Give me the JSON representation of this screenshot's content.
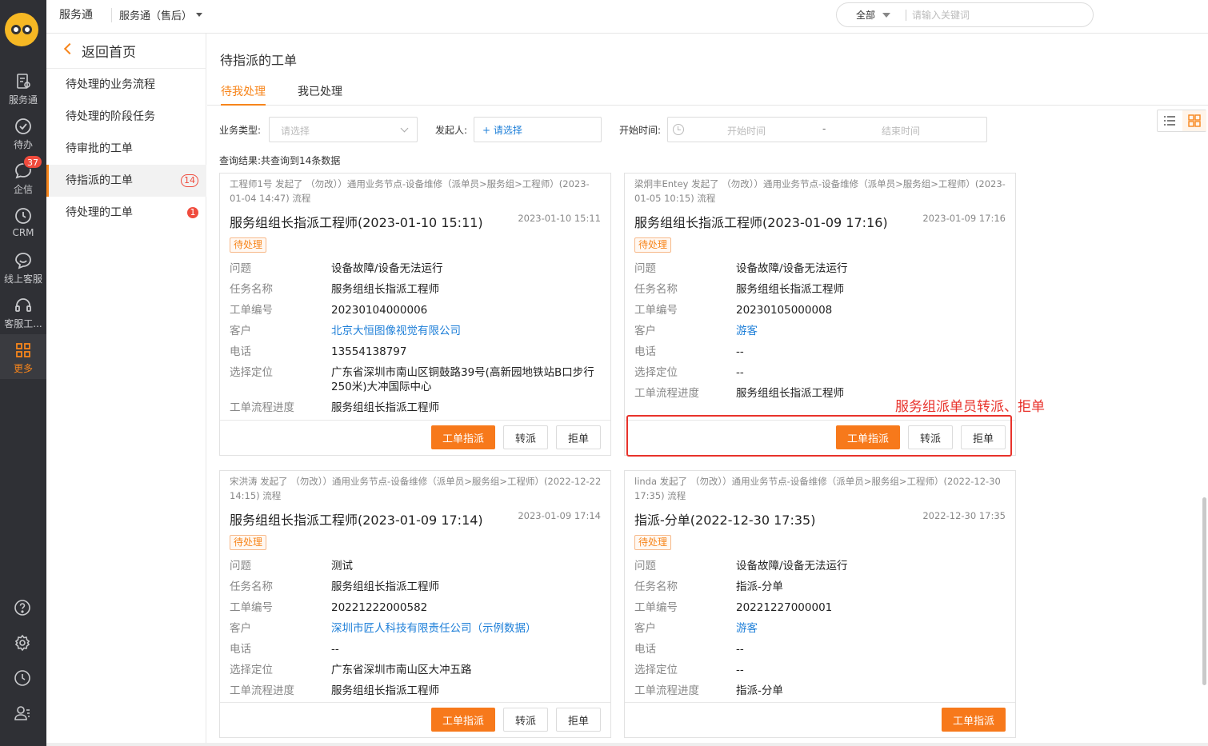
{
  "colors": {
    "accent": "#f7851b",
    "primary_button": "#f7791b",
    "link": "#1e7fd8",
    "badge": "#f04b3d",
    "rail_bg": "#2f3035",
    "annotation": "#e8322b"
  },
  "rail": {
    "items": [
      {
        "label": "服务通",
        "icon": "service-icon"
      },
      {
        "label": "待办",
        "icon": "check-circle-icon"
      },
      {
        "label": "企信",
        "icon": "chat-bubble-icon",
        "badge": "37"
      },
      {
        "label": "CRM",
        "icon": "clock-icon"
      },
      {
        "label": "线上客服",
        "icon": "online-service-icon"
      },
      {
        "label": "客服工...",
        "icon": "headset-icon"
      },
      {
        "label": "更多",
        "icon": "grid-icon"
      }
    ],
    "bottom_icons": [
      "help-icon",
      "settings-icon",
      "history-icon",
      "contacts-icon"
    ]
  },
  "topbar": {
    "brand": "服务通",
    "scope": "服务通（售后）",
    "search_scope": "全部",
    "search_placeholder": "请输入关键词"
  },
  "sidenav": {
    "back": "返回首页",
    "items": [
      {
        "label": "待处理的业务流程"
      },
      {
        "label": "待处理的阶段任务"
      },
      {
        "label": "待审批的工单"
      },
      {
        "label": "待指派的工单",
        "count": "14"
      },
      {
        "label": "待处理的工单",
        "count": "1"
      }
    ]
  },
  "main": {
    "title": "待指派的工单",
    "tabs": [
      "待我处理",
      "我已处理"
    ],
    "filters": {
      "type_label": "业务类型:",
      "type_placeholder": "请选择",
      "initiator_label": "发起人:",
      "initiator_placeholder": "+ 请选择",
      "time_label": "开始时间:",
      "start_placeholder": "开始时间",
      "range_sep": "-",
      "end_placeholder": "结束时间"
    },
    "result_text": "查询结果:共查询到14条数据"
  },
  "field_labels": [
    "问题",
    "任务名称",
    "工单编号",
    "客户",
    "电话",
    "选择定位",
    "工单流程进度"
  ],
  "buttons": {
    "assign": "工单指派",
    "transfer": "转派",
    "reject": "拒单"
  },
  "cards": [
    {
      "initiator": "工程师1号 发起了 （勿改））通用业务节点-设备维修（派单员>服务组>工程师）(2023-01-04 14:47) 流程",
      "title": "服务组组长指派工程师(2023-01-10 15:11)",
      "time": "2023-01-10 15:11",
      "status": "待处理",
      "values": [
        "设备故障/设备无法运行",
        "服务组组长指派工程师",
        "20230104000006",
        "北京大恒图像视觉有限公司",
        "13554138797",
        "广东省深圳市南山区铜鼓路39号(高新园地铁站B口步行250米)大冲国际中心",
        "服务组组长指派工程师"
      ]
    },
    {
      "initiator": "梁炯丰Entey 发起了 （勿改））通用业务节点-设备维修（派单员>服务组>工程师）(2023-01-05 10:15) 流程",
      "title": "服务组组长指派工程师(2023-01-09 17:16)",
      "time": "2023-01-09 17:16",
      "status": "待处理",
      "values": [
        "设备故障/设备无法运行",
        "服务组组长指派工程师",
        "20230105000008",
        "游客",
        "--",
        "--",
        "服务组组长指派工程师"
      ]
    },
    {
      "initiator": "宋洪涛 发起了 （勿改））通用业务节点-设备维修（派单员>服务组>工程师）(2022-12-22 14:15) 流程",
      "title": "服务组组长指派工程师(2023-01-09 17:14)",
      "time": "2023-01-09 17:14",
      "status": "待处理",
      "values": [
        "测试",
        "服务组组长指派工程师",
        "20221222000582",
        "深圳市匠人科技有限责任公司（示例数据）",
        "--",
        "广东省深圳市南山区大冲五路",
        "服务组组长指派工程师"
      ]
    },
    {
      "initiator": "linda 发起了 （勿改））通用业务节点-设备维修（派单员>服务组>工程师）(2022-12-30 17:35) 流程",
      "title": "指派-分单(2022-12-30 17:35)",
      "time": "2022-12-30 17:35",
      "status": "待处理",
      "values": [
        "设备故障/设备无法运行",
        "指派-分单",
        "20221227000001",
        "游客",
        "--",
        "--",
        "指派-分单"
      ]
    }
  ],
  "annotation": "服务组派单员转派、拒单"
}
